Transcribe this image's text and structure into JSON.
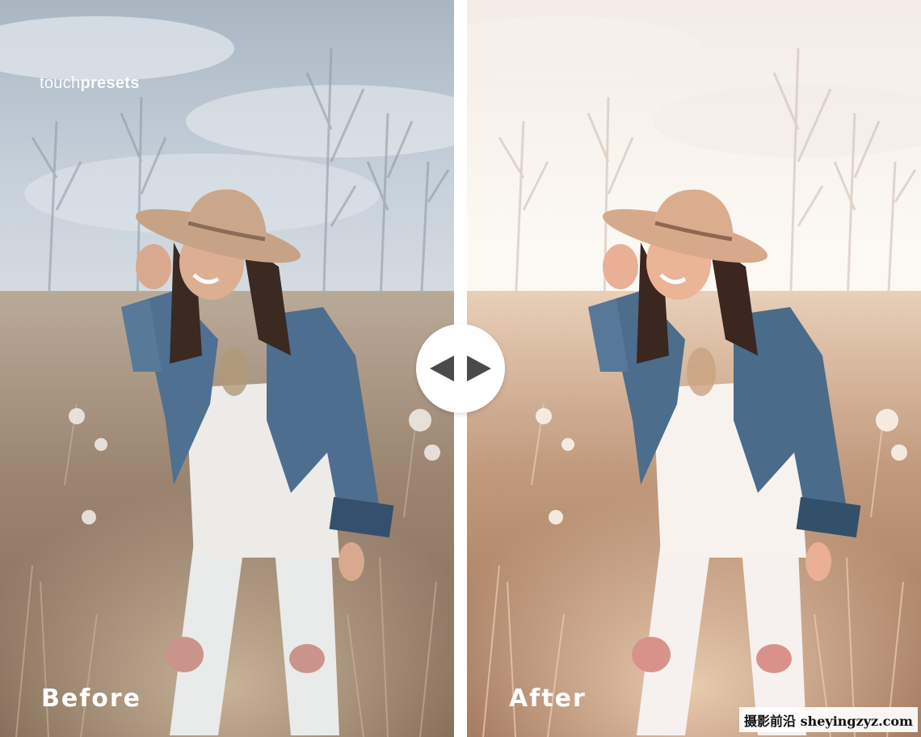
{
  "brand": {
    "light": "touch",
    "bold": "presets"
  },
  "labels": {
    "before": "Before",
    "after": "After"
  },
  "watermark": {
    "text": "摄影前沿 sheyingzyz.com"
  },
  "compare_handle": {
    "left_icon": "triangle-left-icon",
    "right_icon": "triangle-right-icon"
  },
  "colors": {
    "before_sky": "#c9d3dc",
    "after_sky": "#fbf6f1",
    "before_ground": "#9a8470",
    "after_ground": "#b88e72",
    "hat": "#c9a589",
    "denim": "#4d6e8f",
    "handle_arrow": "#4a4a4a"
  }
}
